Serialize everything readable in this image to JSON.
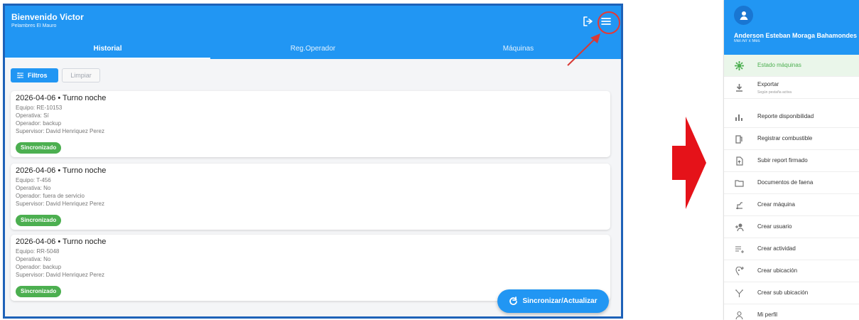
{
  "app": {
    "welcome_title": "Bienvenido Victor",
    "subtitle": "Pelambres El Mauro",
    "tabs": [
      {
        "label": "Historial"
      },
      {
        "label": "Reg.Operador"
      },
      {
        "label": "Máquinas"
      }
    ],
    "buttons": {
      "filters": "Filtros",
      "clear": "Limpiar",
      "sync": "Sincronizar/Actualizar"
    },
    "records": [
      {
        "title": "2026-04-06 • Turno noche",
        "equipment": "Equipo: RE-10153",
        "operational": "Operativa: Sí",
        "operator": "Operador: backup",
        "supervisor": "Supervisor: David Henriquez Perez",
        "status": "Sincronizado"
      },
      {
        "title": "2026-04-06 • Turno noche",
        "equipment": "Equipo: T-456",
        "operational": "Operativa: No",
        "operator": "Operador: fuera de servicio",
        "supervisor": "Supervisor: David Henriquez Perez",
        "status": "Sincronizado"
      },
      {
        "title": "2026-04-06 • Turno noche",
        "equipment": "Equipo: RR-5048",
        "operational": "Operativa: No",
        "operator": "Operador: backup",
        "supervisor": "Supervisor: David Henriquez Perez",
        "status": "Sincronizado"
      }
    ]
  },
  "drawer": {
    "user_name": "Anderson Esteban Moraga Bahamondes",
    "role": "Mel Arr x Mes",
    "items": [
      {
        "label": "Estado máquinas",
        "icon": "gear-icon"
      },
      {
        "label": "Exportar",
        "sublabel": "Según pestaña activa",
        "icon": "download-icon"
      },
      {
        "label": "Reporte disponibilidad",
        "icon": "chart-icon"
      },
      {
        "label": "Registrar combustible",
        "icon": "fuel-icon"
      },
      {
        "label": "Subir report firmado",
        "icon": "upload-document-icon"
      },
      {
        "label": "Documentos de faena",
        "icon": "folder-icon"
      },
      {
        "label": "Crear máquina",
        "icon": "machine-icon"
      },
      {
        "label": "Crear usuario",
        "icon": "add-user-icon"
      },
      {
        "label": "Crear actividad",
        "icon": "add-activity-icon"
      },
      {
        "label": "Crear ubicación",
        "icon": "add-location-icon"
      },
      {
        "label": "Crear sub ubicación",
        "icon": "fork-icon"
      },
      {
        "label": "Mi perfil",
        "icon": "profile-icon"
      }
    ]
  },
  "colors": {
    "primary": "#2196f3",
    "success": "#4caf50",
    "annotation": "#e53935",
    "frame": "#1e62b8"
  }
}
